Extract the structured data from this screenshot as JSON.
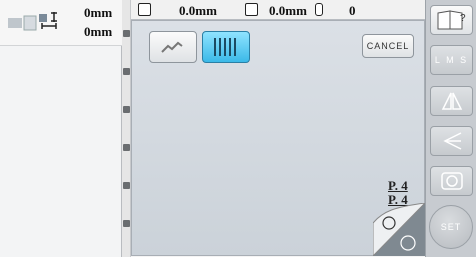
{
  "left_panel": {
    "height_value": "0mm",
    "width_value": "0mm"
  },
  "topbar": {
    "height_readout": "0.0mm",
    "width_readout": "0.0mm",
    "stitch_count": "0"
  },
  "main": {
    "cancel_label": "CANCEL",
    "page_current": "P. 4",
    "page_total": "P. 4"
  },
  "right_toolbar": {
    "lms_label": "L M S",
    "set_label": "SET"
  },
  "colors": {
    "selected": "#3bb9e8",
    "canvas": "#d3d9e0",
    "toolbar": "#c7cbd0"
  }
}
